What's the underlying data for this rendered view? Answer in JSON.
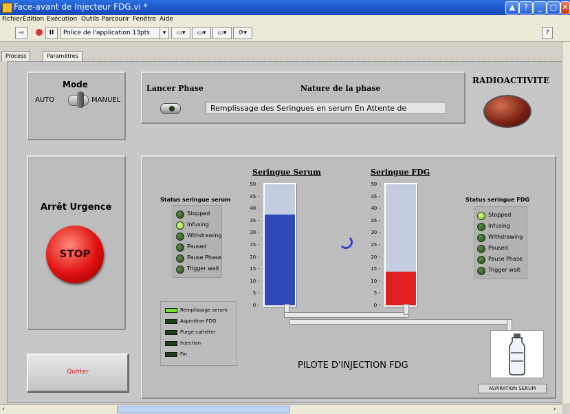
{
  "window": {
    "title": "Face-avant de Injecteur FDG.vi *",
    "controls": [
      "restore",
      "help",
      "minimize",
      "maximize",
      "close"
    ]
  },
  "menu": [
    "Fichier",
    "Édition",
    "Exécution",
    "Outils",
    "Parcourir",
    "Fenêtre",
    "Aide"
  ],
  "toolbar": {
    "font_select": "Police de l'application 13pts"
  },
  "tabs": [
    {
      "label": "Process",
      "active": false
    },
    {
      "label": "Paramètres",
      "active": true
    }
  ],
  "mode": {
    "title": "Mode",
    "left": "AUTO",
    "right": "MANUEL"
  },
  "phase": {
    "launch_label": "Lancer Phase",
    "nature_label": "Nature de la phase",
    "nature_value": "Remplissage des Seringues en serum En Attente de"
  },
  "radio": {
    "label": "RADIOACTIVITE",
    "led_color": "#7a1f12"
  },
  "urgence": {
    "label": "Arrêt Urgence",
    "stop_label": "STOP",
    "stop_color": "#e01010"
  },
  "quit": {
    "label": "Quitter"
  },
  "status_serum": {
    "title": "Status seringue serum",
    "items": [
      {
        "label": "Stopped",
        "on": false
      },
      {
        "label": "Infusing",
        "on": true
      },
      {
        "label": "Withdrawing",
        "on": false
      },
      {
        "label": "Paused",
        "on": false
      },
      {
        "label": "Pause Phase",
        "on": false
      },
      {
        "label": "Trigger wait",
        "on": false
      }
    ]
  },
  "status_fdg": {
    "title": "Status seringue FDG",
    "items": [
      {
        "label": "Stopped",
        "on": true
      },
      {
        "label": "Infusing",
        "on": false
      },
      {
        "label": "Withdrawing",
        "on": false
      },
      {
        "label": "Paused",
        "on": false
      },
      {
        "label": "Pause Phase",
        "on": false
      },
      {
        "label": "Trigger wait",
        "on": false
      }
    ]
  },
  "steps": {
    "items": [
      {
        "label": "Remplissage serum",
        "on": true
      },
      {
        "label": "Aspiration FDG",
        "on": false
      },
      {
        "label": "Purge cathéter",
        "on": false
      },
      {
        "label": "Injection",
        "on": false
      },
      {
        "label": "Fin",
        "on": false
      }
    ]
  },
  "syringes": {
    "scale_ticks": [
      "50",
      "45",
      "40",
      "35",
      "30",
      "25",
      "20",
      "15",
      "10",
      "5",
      "0"
    ],
    "serum": {
      "title": "Seringue Serum",
      "level": 37.5,
      "max": 50,
      "color": "#2f49b8"
    },
    "fdg": {
      "title": "Seringue FDG",
      "level": 14,
      "max": 50,
      "color": "#e02020"
    }
  },
  "pilot_label": "PILOTE D'INJECTION FDG",
  "aspiration_label": "ASPIRATION SERUM"
}
